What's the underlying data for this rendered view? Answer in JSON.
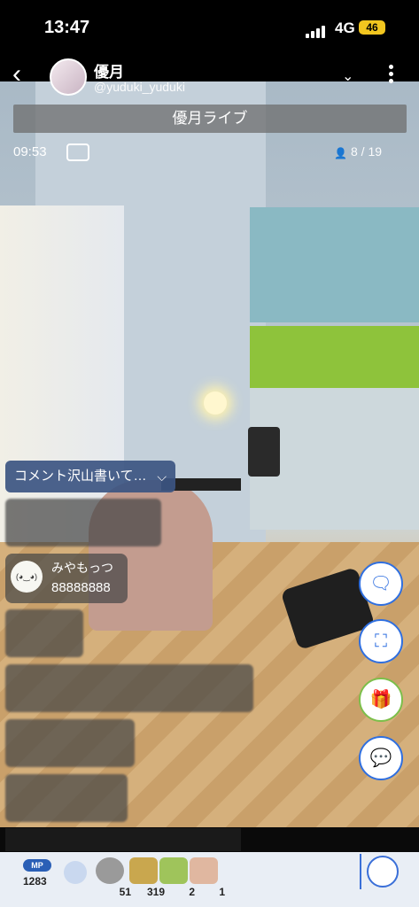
{
  "status": {
    "time": "13:47",
    "network": "4G",
    "battery": "46"
  },
  "header": {
    "username": "優月",
    "userid": "@yuduki_yuduki"
  },
  "title": "優月ライブ",
  "elapsed": "09:53",
  "viewers": "8 / 19",
  "comment_banner": "コメント沢山書いて…",
  "comment": {
    "user": "みやもっつ",
    "text": "88888888"
  },
  "gifts": {
    "mp_label": "MP",
    "mp": "1283",
    "counts": [
      "51",
      "319",
      "2",
      "1"
    ]
  },
  "icons": [
    "back-icon",
    "chevron-down-icon",
    "more-icon",
    "comment-icon",
    "viewer-icon",
    "stamp-icon",
    "capture-icon",
    "gift-icon",
    "chat-icon"
  ],
  "colors": {
    "accent": "#2f6fe0",
    "banner": "#3c5582"
  }
}
